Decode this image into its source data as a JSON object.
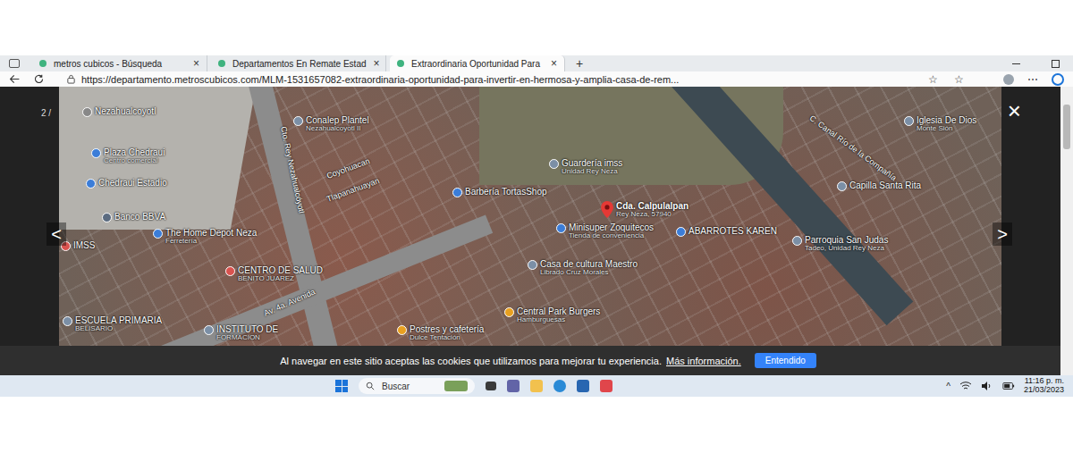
{
  "browser": {
    "tabs": [
      {
        "label": "metros cubicos - Búsqueda",
        "selected": false
      },
      {
        "label": "Departamentos En Remate Estad",
        "selected": false
      },
      {
        "label": "Extraordinaria Oportunidad Para",
        "selected": true
      }
    ],
    "new_tab": "+",
    "tab_close": "×",
    "address_bar": {
      "url": "https://departamento.metroscubicos.com/MLM-1531657082-extraordinaria-oportunidad-para-invertir-en-hermosa-y-amplia-casa-de-rem..."
    }
  },
  "gallery": {
    "counter": "2 / ",
    "close": "×",
    "prev": "<",
    "next": ">"
  },
  "map": {
    "pins": [
      {
        "label": "Nezahualcoyotl",
        "sub": "",
        "kind": "place",
        "color": "#888888"
      },
      {
        "label": "Conalep Plantel",
        "sub": "Nezahualcoyotl II",
        "kind": "place",
        "color": "#7b8fa6"
      },
      {
        "label": "Plaza Chedraui",
        "sub": "Centro comercial",
        "kind": "place",
        "color": "#3b7dd8"
      },
      {
        "label": "Chedraui Estadio",
        "sub": "",
        "kind": "place",
        "color": "#3b7dd8"
      },
      {
        "label": "Banco BBVA",
        "sub": "",
        "kind": "place",
        "color": "#5b6b80"
      },
      {
        "label": "The Home Depot Neza",
        "sub": "Ferretería",
        "kind": "place",
        "color": "#3b7dd8"
      },
      {
        "label": "IMSS",
        "sub": "",
        "kind": "place",
        "color": "#d9534f"
      },
      {
        "label": "CENTRO DE SALUD",
        "sub": "BENITO JUAREZ",
        "kind": "place",
        "color": "#d9534f"
      },
      {
        "label": "ESCUELA PRIMARIA",
        "sub": "BELISARIO",
        "kind": "place",
        "color": "#7b8fa6"
      },
      {
        "label": "INSTITUTO DE",
        "sub": "FORMACION",
        "kind": "place",
        "color": "#7b8fa6"
      },
      {
        "label": "Postres y cafetería",
        "sub": "Dulce Tentación",
        "kind": "place",
        "color": "#e8a020"
      },
      {
        "label": "Central Park Burgers",
        "sub": "Hamburguesas",
        "kind": "place",
        "color": "#e8a020"
      },
      {
        "label": "Casa de cultura Maestro",
        "sub": "Librado Cruz Morales",
        "kind": "place",
        "color": "#7b8fa6"
      },
      {
        "label": "Minisuper Zoquitecos",
        "sub": "Tienda de conveniencia",
        "kind": "place",
        "color": "#3b7dd8"
      },
      {
        "label": "Cda. Calpulalpan",
        "sub": "Rey Neza, 57940",
        "kind": "target",
        "color": "#e53935"
      },
      {
        "label": "Guardería imss",
        "sub": "Unidad Rey Neza",
        "kind": "place",
        "color": "#7b8fa6"
      },
      {
        "label": "Barbería TortasShop",
        "sub": "",
        "kind": "place",
        "color": "#3b7dd8"
      },
      {
        "label": "ABARROTES KAREN",
        "sub": "",
        "kind": "place",
        "color": "#3b7dd8"
      },
      {
        "label": "Parroquia San Judas",
        "sub": "Tadeo, Unidad Rey Neza",
        "kind": "place",
        "color": "#7b8fa6"
      },
      {
        "label": "Capilla Santa Rita",
        "sub": "",
        "kind": "place",
        "color": "#7b8fa6"
      },
      {
        "label": "Iglesia De Dios",
        "sub": "Monte Sión",
        "kind": "place",
        "color": "#7b8fa6"
      },
      {
        "label": "Coyohuacan",
        "sub": "",
        "kind": "street",
        "color": "#ffffff"
      },
      {
        "label": "Tlapanahuayan",
        "sub": "",
        "kind": "street",
        "color": "#ffffff"
      },
      {
        "label": "Cto. Rey Nezahualcóyotl",
        "sub": "",
        "kind": "street",
        "color": "#ffffff"
      },
      {
        "label": "Av. 4a. Avenida",
        "sub": "",
        "kind": "street",
        "color": "#ffffff"
      },
      {
        "label": "C. Canal Río de la Compañía",
        "sub": "",
        "kind": "street",
        "color": "#ffffff"
      }
    ]
  },
  "cookie_bar": {
    "text": "Al navegar en este sitio aceptas las cookies que utilizamos para mejorar tu experiencia.",
    "link": "Más información.",
    "button": "Entendido"
  },
  "taskbar": {
    "search_placeholder": "Buscar",
    "tray_arrow": "^",
    "time": "11:16 p. m.",
    "date": "21/03/2023"
  }
}
